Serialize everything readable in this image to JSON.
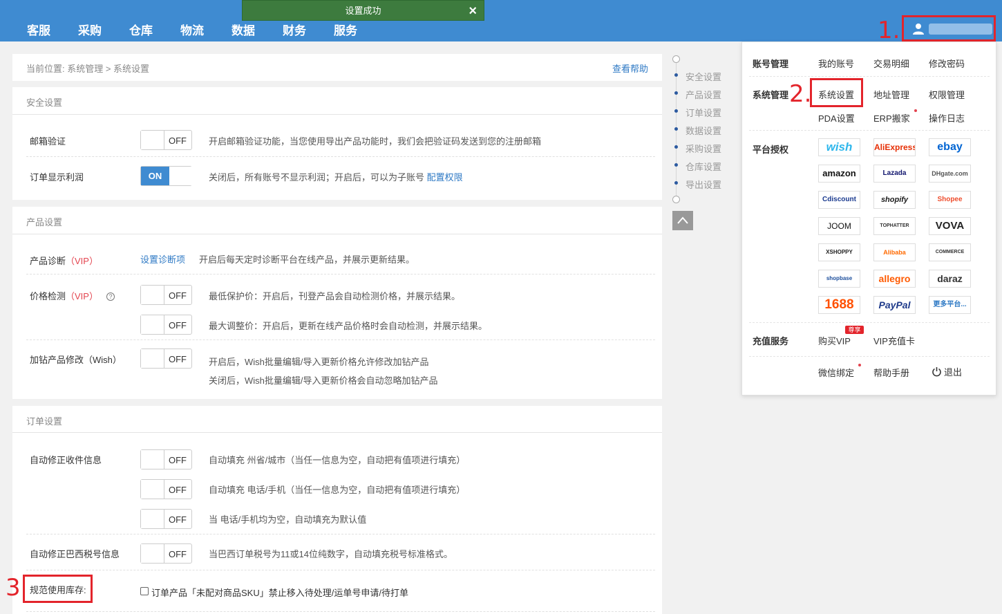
{
  "nav": {
    "items": [
      "客服",
      "采购",
      "仓库",
      "物流",
      "数据",
      "财务",
      "服务"
    ]
  },
  "toast": {
    "message": "设置成功",
    "close": "×"
  },
  "annotations": {
    "one": "1.",
    "two": "2.",
    "three": "3"
  },
  "breadcrumb": {
    "text": "当前位置:  系统管理 > 系统设置",
    "help": "查看帮助"
  },
  "security": {
    "title": "安全设置",
    "email": {
      "label": "邮箱验证",
      "state": "OFF",
      "desc": "开启邮箱验证功能，当您使用导出产品功能时，我们会把验证码发送到您的注册邮箱"
    },
    "profit": {
      "label": "订单显示利润",
      "state": "ON",
      "desc": "关闭后，所有账号不显示利润；开启后，可以为子账号",
      "link": "配置权限"
    }
  },
  "product": {
    "title": "产品设置",
    "diagnosis": {
      "label": "产品诊断",
      "vip": "（VIP）",
      "link": "设置诊断项",
      "desc": "开启后每天定时诊断平台在线产品，并展示更新结果。"
    },
    "price_check": {
      "label": "价格检测",
      "vip": "（VIP）",
      "help": "?",
      "min": {
        "state": "OFF",
        "desc": "最低保护价：开启后，刊登产品会自动检测价格，并展示结果。"
      },
      "max": {
        "state": "OFF",
        "desc": "最大调整价：开启后，更新在线产品价格时会自动检测，并展示结果。"
      }
    },
    "drill": {
      "label": "加钻产品修改（Wish）",
      "state": "OFF",
      "desc1": "开启后，Wish批量编辑/导入更新价格允许修改加钻产品",
      "desc2": "关闭后，Wish批量编辑/导入更新价格会自动忽略加钻产品"
    }
  },
  "order": {
    "title": "订单设置",
    "auto_fix": {
      "label": "自动修正收件信息",
      "rows": [
        {
          "state": "OFF",
          "desc": "自动填充 州省/城市（当任一信息为空，自动把有值项进行填充）"
        },
        {
          "state": "OFF",
          "desc": "自动填充 电话/手机（当任一信息为空，自动把有值项进行填充）"
        },
        {
          "state": "OFF",
          "desc": "当 电话/手机均为空，自动填充为默认值"
        }
      ]
    },
    "brazil": {
      "label": "自动修正巴西税号信息",
      "state": "OFF",
      "desc": "当巴西订单税号为11或14位纯数字，自动填充税号标准格式。"
    },
    "stock": {
      "label": "规范使用库存:",
      "checkbox": "订单产品「未配对商品SKU」禁止移入待处理/运单号申请/待打单"
    }
  },
  "side_nav": [
    "安全设置",
    "产品设置",
    "订单设置",
    "数据设置",
    "采购设置",
    "仓库设置",
    "导出设置"
  ],
  "dropdown": {
    "account": {
      "head": "账号管理",
      "items": [
        "我的账号",
        "交易明细",
        "修改密码"
      ]
    },
    "system": {
      "head": "系统管理",
      "items": [
        "系统设置",
        "地址管理",
        "权限管理",
        "PDA设置",
        "ERP搬家",
        "操作日志"
      ]
    },
    "platform": {
      "head": "平台授权",
      "logos": [
        "wish",
        "AliExpress",
        "ebay",
        "amazon",
        "Lazada",
        "DHgate.com",
        "Cdiscount",
        "shopify",
        "Shopee",
        "JOOM",
        "TOPHATTER",
        "VOVA",
        "XSHOPPY",
        "Alibaba",
        "COMMERCE",
        "shopbase",
        "allegro",
        "daraz",
        "1688",
        "PayPal",
        "更多平台..."
      ]
    },
    "recharge": {
      "head": "充值服务",
      "items": [
        "购买VIP",
        "VIP充值卡"
      ],
      "tag": "尊享"
    },
    "bottom": [
      "微信绑定",
      "帮助手册",
      "退出"
    ]
  },
  "colors": {
    "brand": "#3f8bd1",
    "toast": "#3d7b3e",
    "annotation": "#e3242b",
    "link": "#2f7ac5",
    "vip": "#e3434e"
  }
}
